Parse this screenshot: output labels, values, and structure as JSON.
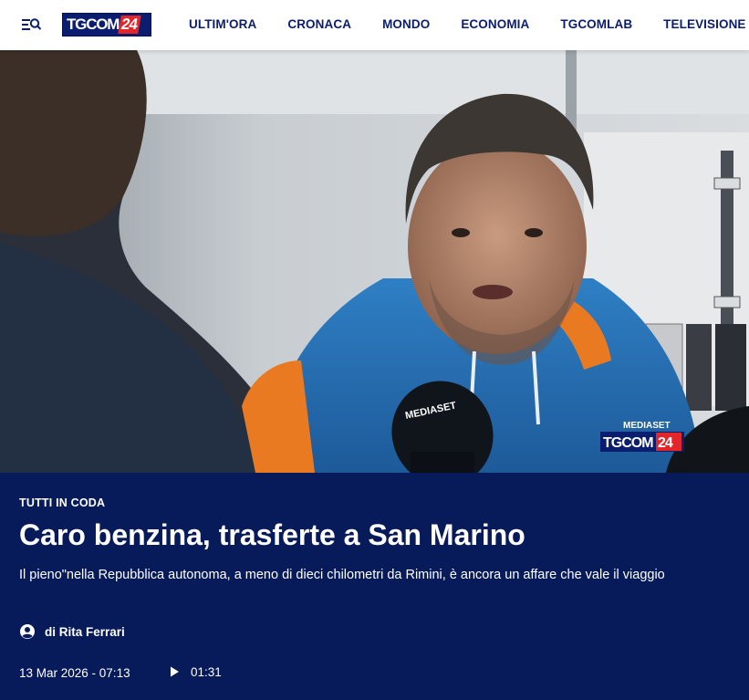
{
  "header": {
    "logo_text": "TGCOM",
    "logo_badge": "24",
    "menu_icon": "menu-search-icon",
    "nav": [
      "ULTIM'ORA",
      "CRONACA",
      "MONDO",
      "ECONOMIA",
      "TGCOMLAB",
      "TELEVISIONE"
    ]
  },
  "hero": {
    "watermark_top": "MEDIASET",
    "watermark_logo": "TGCOM",
    "watermark_badge": "24",
    "mic_label": "MEDIASET"
  },
  "article": {
    "kicker": "TUTTI IN CODA",
    "title": "Caro benzina, trasferte a San Marino",
    "summary": "Il pieno\"nella Repubblica autonoma, a meno di dieci chilometri da Rimini, è ancora un affare che vale il viaggio",
    "author_prefix": "di",
    "author": "Rita Ferrari",
    "date": "13 Mar 2026 - 07:13",
    "video_duration": "01:31",
    "author_icon": "user-circle-icon",
    "video_icon": "play-icon"
  },
  "colors": {
    "brand_navy": "#071a59",
    "nav_text": "#0b1d6f",
    "brand_red": "#e3262a"
  }
}
